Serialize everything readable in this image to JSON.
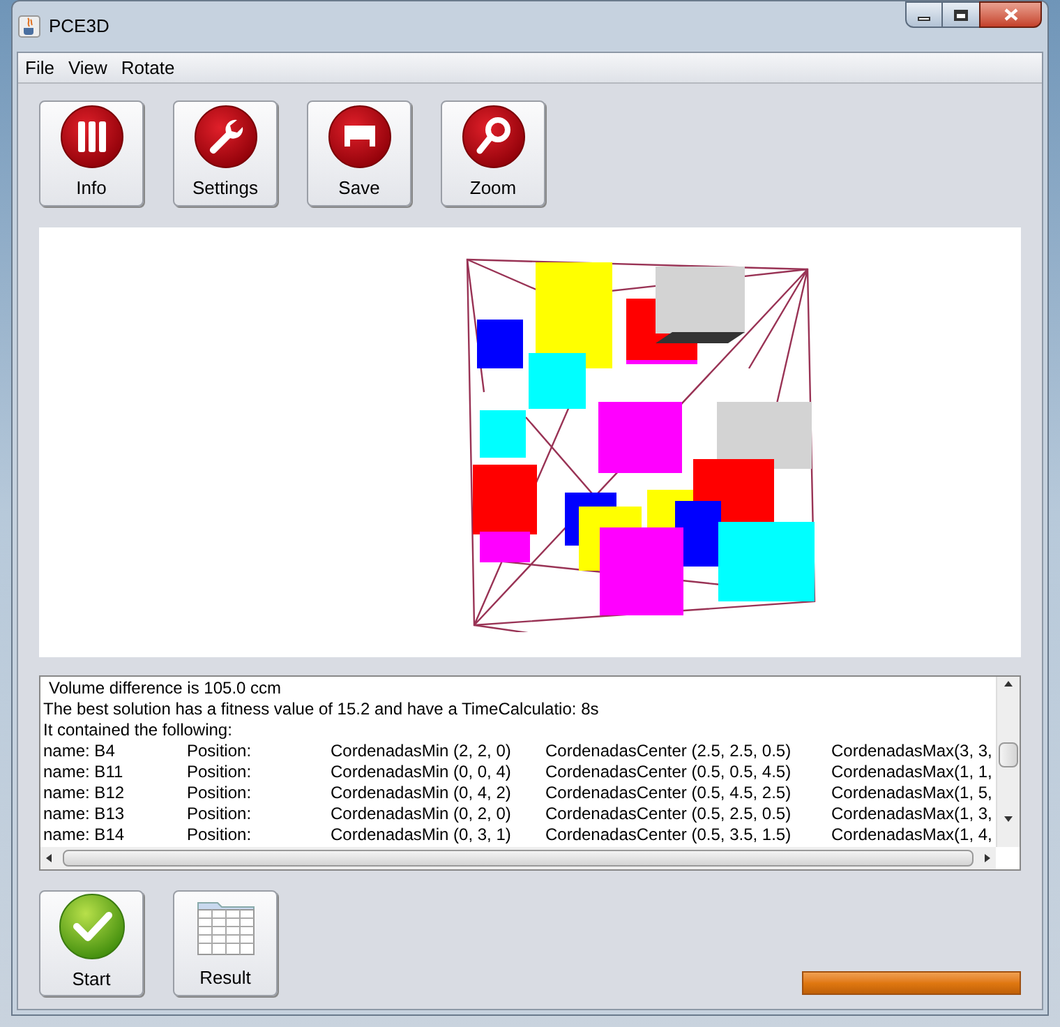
{
  "window": {
    "title": "PCE3D"
  },
  "menu": [
    "File",
    "View",
    "Rotate"
  ],
  "toolbar": [
    {
      "label": "Info",
      "kind": "info"
    },
    {
      "label": "Settings",
      "kind": "settings"
    },
    {
      "label": "Save",
      "kind": "save"
    },
    {
      "label": "Zoom",
      "kind": "zoom"
    }
  ],
  "output": {
    "lines": [
      "Volume difference is 105.0 ccm",
      "The best solution has a fitness value of 15.2 and have a TimeCalculatio: 8s",
      "It contained the following:"
    ],
    "rows": [
      {
        "name": "name: B4",
        "position": "Position:",
        "min": "CordenadasMin (2, 2, 0)",
        "center": "CordenadasCenter (2.5, 2.5, 0.5)",
        "max": "CordenadasMax(3, 3,"
      },
      {
        "name": "name: B11",
        "position": "Position:",
        "min": "CordenadasMin (0, 0, 4)",
        "center": "CordenadasCenter (0.5, 0.5, 4.5)",
        "max": "CordenadasMax(1, 1,"
      },
      {
        "name": "name: B12",
        "position": "Position:",
        "min": "CordenadasMin (0, 4, 2)",
        "center": "CordenadasCenter (0.5, 4.5, 2.5)",
        "max": "CordenadasMax(1, 5,"
      },
      {
        "name": "name: B13",
        "position": "Position:",
        "min": "CordenadasMin (0, 2, 0)",
        "center": "CordenadasCenter (0.5, 2.5, 0.5)",
        "max": "CordenadasMax(1, 3,"
      },
      {
        "name": "name: B14",
        "position": "Position:",
        "min": "CordenadasMin (0, 3, 1)",
        "center": "CordenadasCenter (0.5, 3.5, 1.5)",
        "max": "CordenadasMax(1, 4,"
      }
    ]
  },
  "actions": [
    {
      "label": "Start",
      "kind": "start"
    },
    {
      "label": "Result",
      "kind": "result"
    }
  ],
  "progress": {
    "level": 1
  }
}
